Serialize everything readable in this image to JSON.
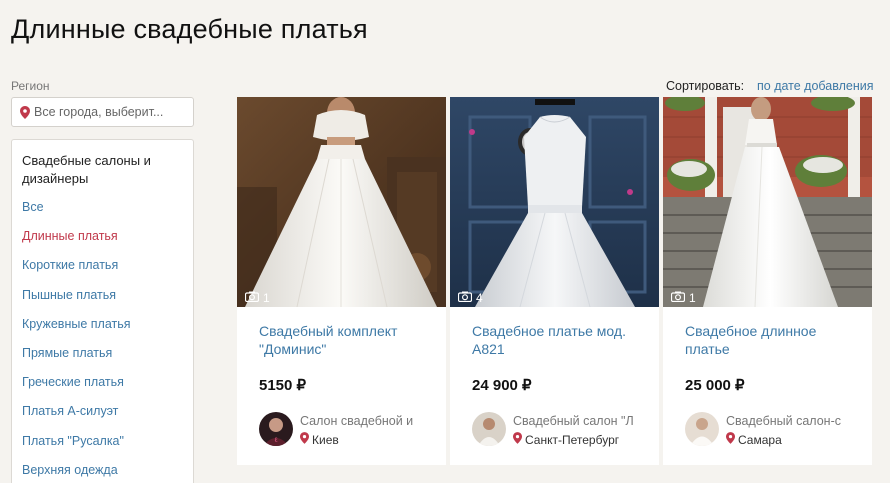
{
  "page": {
    "title": "Длинные свадебные платья"
  },
  "filters": {
    "region_label": "Регион",
    "city_placeholder": "Все города, выберит..."
  },
  "sidebar": {
    "heading": "Свадебные салоны и дизайнеры",
    "items": [
      {
        "label": "Все"
      },
      {
        "label": "Длинные платья",
        "active": true
      },
      {
        "label": "Короткие платья"
      },
      {
        "label": "Пышные платья"
      },
      {
        "label": "Кружевные платья"
      },
      {
        "label": "Прямые платья"
      },
      {
        "label": "Греческие платья"
      },
      {
        "label": "Платья А-силуэт"
      },
      {
        "label": "Платья \"Русалка\""
      },
      {
        "label": "Верхняя одежда"
      }
    ]
  },
  "sort": {
    "label": "Сортировать:",
    "value": "по дате добавления"
  },
  "products": [
    {
      "photo_count": "1",
      "title": "Свадебный комплект \"Доминис\"",
      "price": "5150 ₽",
      "seller": "Салон свадебной и",
      "location": "Киев"
    },
    {
      "photo_count": "4",
      "title": "Свадебное платье мод. А821",
      "price": "24 900 ₽",
      "seller": "Свадебный салон \"Л",
      "location": "Санкт-Петербург"
    },
    {
      "photo_count": "1",
      "title": "Свадебное длинное платье",
      "price": "25 000 ₽",
      "seller": "Свадебный салон-с",
      "location": "Самара"
    }
  ],
  "colors": {
    "link": "#3e79a6",
    "active": "#c0394b",
    "background": "#f5f3ef"
  },
  "icons": {
    "location": "map-pin-icon",
    "photos": "camera-icon"
  }
}
